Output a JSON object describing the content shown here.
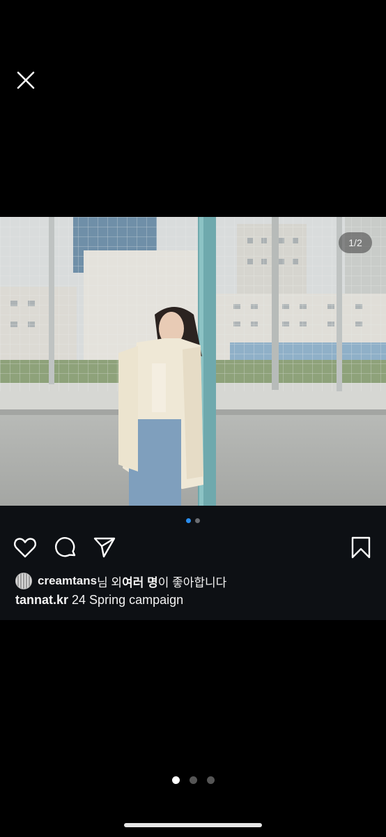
{
  "viewer": {
    "close_icon": "close-icon"
  },
  "post": {
    "image_counter": "1/2",
    "image_description": "Woman in cream blazer and jeans leaning against a teal fence pole in front of a school building",
    "photo_dots": {
      "count": 2,
      "active": 0
    },
    "actions": {
      "like_icon": "heart-icon",
      "comment_icon": "comment-icon",
      "share_icon": "send-icon",
      "save_icon": "bookmark-icon"
    },
    "likes": {
      "username": "creamtans",
      "text_a": "님 외 ",
      "text_bold": "여러 명",
      "text_b": "이 좋아합니다"
    },
    "caption": {
      "username": "tannat.kr",
      "text": " 24 Spring campaign"
    }
  },
  "gallery": {
    "page_dots": {
      "count": 3,
      "active": 0
    }
  },
  "colors": {
    "background": "#000000",
    "card": "#0d1014",
    "accent_dot": "#2a8ef0"
  }
}
